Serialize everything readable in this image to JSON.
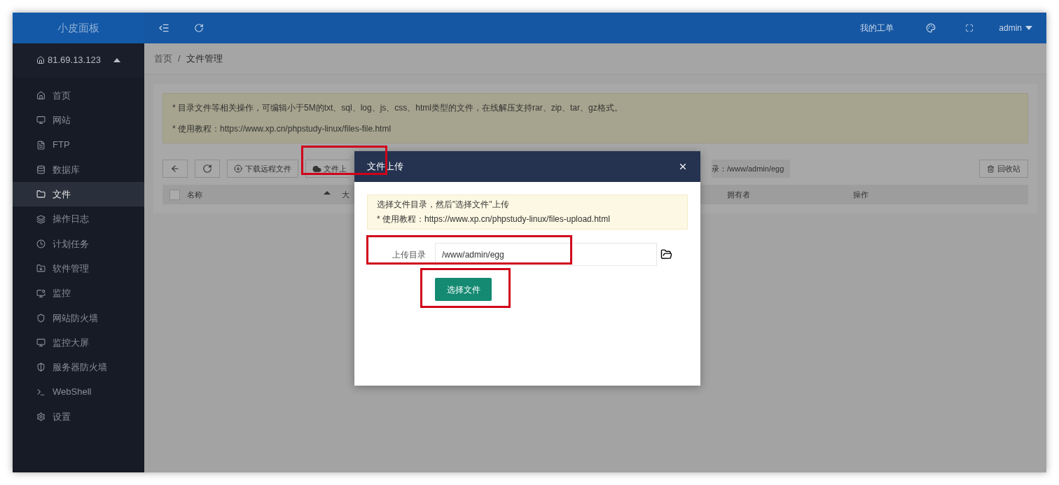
{
  "brand": "小皮面板",
  "header": {
    "links": [
      "我的工单"
    ],
    "user": "admin"
  },
  "sidebar": {
    "host": "81.69.13.123",
    "expanded": true,
    "items": [
      {
        "label": "首页",
        "selected": false
      },
      {
        "label": "网站",
        "selected": false
      },
      {
        "label": "FTP",
        "selected": false
      },
      {
        "label": "数据库",
        "selected": false
      },
      {
        "label": "文件",
        "selected": true
      },
      {
        "label": "操作日志",
        "selected": false
      },
      {
        "label": "计划任务",
        "selected": false
      },
      {
        "label": "软件管理",
        "selected": false
      },
      {
        "label": "监控",
        "selected": false
      },
      {
        "label": "网站防火墙",
        "selected": false
      },
      {
        "label": "监控大屏",
        "selected": false
      },
      {
        "label": "服务器防火墙",
        "selected": false
      },
      {
        "label": "WebShell",
        "selected": false
      },
      {
        "label": "设置",
        "selected": false
      }
    ]
  },
  "breadcrumb": [
    "首页",
    "/",
    "文件管理"
  ],
  "notice": [
    "* 目录文件等相关操作，可编辑小于5M的txt、sql、log、js、css、html类型的文件，在线解压支持rar、zip、tar、gz格式。",
    "* 使用教程：https://www.xp.cn/phpstudy-linux/files-file.html"
  ],
  "toolbar": {
    "download_button": "下载远程文件",
    "upload_button": "文件上",
    "path": "录：/www/admin/egg",
    "recycle_button": "回收站"
  },
  "table": {
    "checked": false,
    "columns": [
      "名称",
      "大",
      "拥有者",
      "操作"
    ]
  },
  "dialog": {
    "title": "文件上传",
    "notice": [
      "选择文件目录，然后\"选择文件\"上传",
      "* 使用教程：https://www.xp.cn/phpstudy-linux/files-upload.html"
    ],
    "field_label": "上传目录",
    "field_value": "/www/admin/egg",
    "button": "选择文件"
  }
}
